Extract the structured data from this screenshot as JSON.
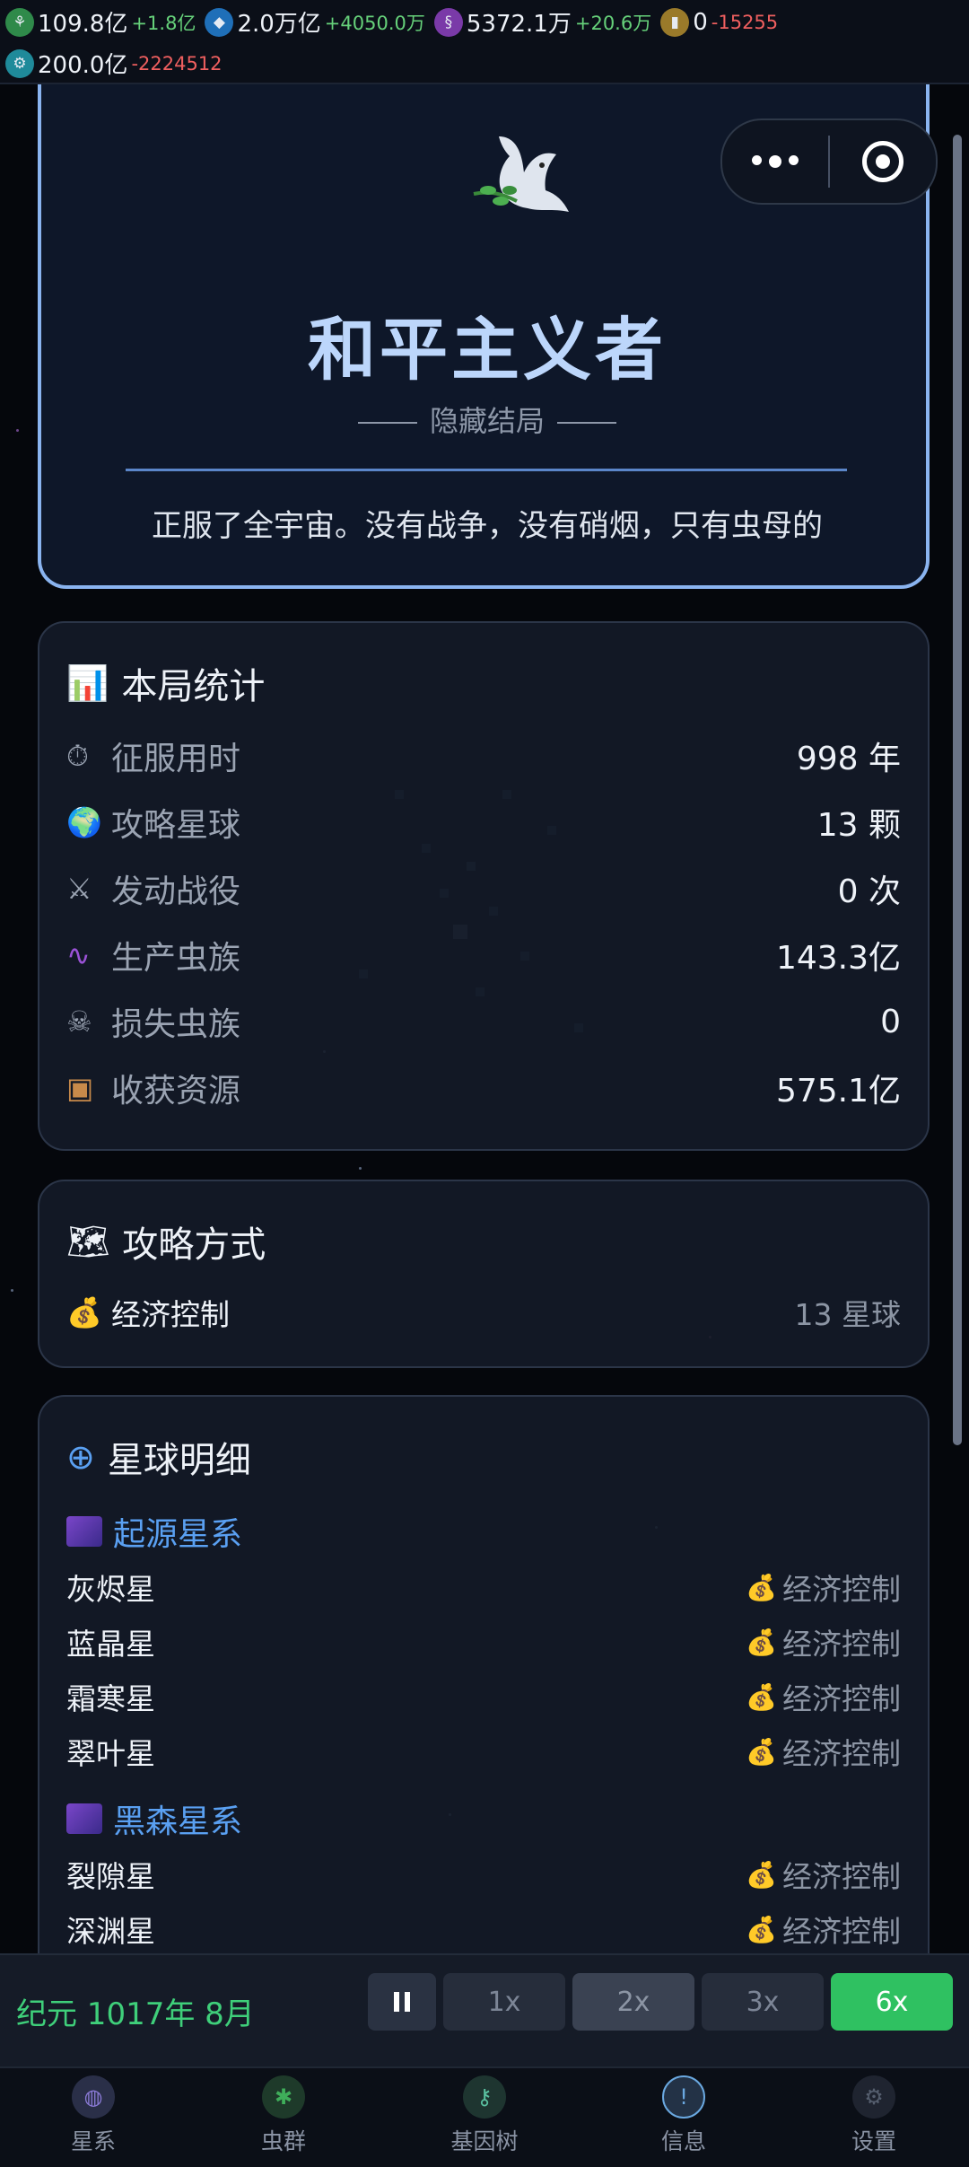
{
  "resources": [
    {
      "icon": "bug-icon",
      "value": "109.8亿",
      "delta": "+1.8亿",
      "delta_type": "pos",
      "color": "#2f8a4a"
    },
    {
      "icon": "diamond-icon",
      "value": "2.0万亿",
      "delta": "+4050.0万",
      "delta_type": "pos",
      "color": "#1f6fb8"
    },
    {
      "icon": "dna-icon",
      "value": "5372.1万",
      "delta": "+20.6万",
      "delta_type": "pos",
      "color": "#7a3aa8"
    },
    {
      "icon": "cell-icon",
      "value": "0",
      "delta": "-15255",
      "delta_type": "neg",
      "color": "#9a7a2a"
    },
    {
      "icon": "gear-icon",
      "value": "200.0亿",
      "delta": "-2224512",
      "delta_type": "neg",
      "color": "#1f8a9a"
    }
  ],
  "ending": {
    "title": "和平主义者",
    "subtitle": "隐藏结局",
    "description": "正服了全宇宙。没有战争，没有硝烟，只有虫母的"
  },
  "stats": {
    "title": "本局统计",
    "rows": [
      {
        "icon": "stopwatch-icon",
        "label": "征服用时",
        "value": "998 年"
      },
      {
        "icon": "globe-icon",
        "label": "攻略星球",
        "value": "13 颗"
      },
      {
        "icon": "swords-icon",
        "label": "发动战役",
        "value": "0 次"
      },
      {
        "icon": "worm-icon",
        "label": "生产虫族",
        "value": "143.3亿"
      },
      {
        "icon": "skull-icon",
        "label": "损失虫族",
        "value": "0"
      },
      {
        "icon": "box-icon",
        "label": "收获资源",
        "value": "575.1亿"
      }
    ]
  },
  "conquest": {
    "title": "攻略方式",
    "method": "经济控制",
    "count": "13 星球"
  },
  "planets": {
    "title": "星球明细",
    "galaxy1": "起源星系",
    "galaxy2": "黑森星系",
    "method": "经济控制",
    "list1": [
      "灰烬星",
      "蓝晶星",
      "霜寒星",
      "翠叶星"
    ],
    "list2": [
      "裂隙星",
      "深渊星"
    ]
  },
  "control": {
    "era": "纪元 1017年 8月",
    "speeds": [
      "1x",
      "2x",
      "3x",
      "6x"
    ],
    "active_speed": "6x"
  },
  "tabs": [
    "星系",
    "虫群",
    "基因树",
    "信息",
    "设置"
  ],
  "colors": {
    "accent": "#2fc161",
    "title": "#bcd6fb",
    "link": "#5aa0f2",
    "card_border": "#8ab4f0"
  }
}
